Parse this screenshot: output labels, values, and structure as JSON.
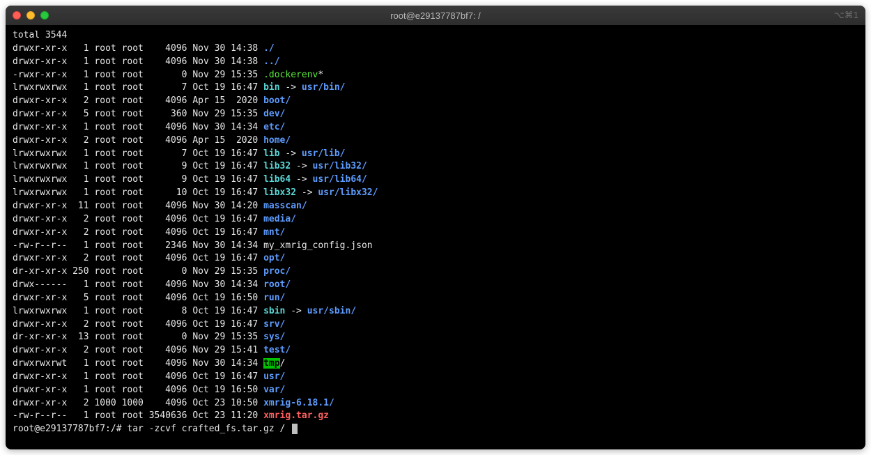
{
  "window": {
    "title": "root@e29137787bf7: /",
    "shell_indicator": "⌥⌘1"
  },
  "total_line": "total 3544",
  "rows": [
    {
      "perm": "drwxr-xr-x",
      "links": "1",
      "owner": "root",
      "group": "root",
      "size": "4096",
      "date": "Nov 30 14:38",
      "name": "./",
      "color": "blue"
    },
    {
      "perm": "drwxr-xr-x",
      "links": "1",
      "owner": "root",
      "group": "root",
      "size": "4096",
      "date": "Nov 30 14:38",
      "name": "../",
      "color": "blue"
    },
    {
      "perm": "-rwxr-xr-x",
      "links": "1",
      "owner": "root",
      "group": "root",
      "size": "0",
      "date": "Nov 29 15:35",
      "name": ".dockerenv",
      "suffix": "*",
      "color": "green"
    },
    {
      "perm": "lrwxrwxrwx",
      "links": "1",
      "owner": "root",
      "group": "root",
      "size": "7",
      "date": "Oct 19 16:47",
      "name": "bin",
      "color": "cyan",
      "arrow": " -> ",
      "target": "usr/bin/",
      "target_color": "blue"
    },
    {
      "perm": "drwxr-xr-x",
      "links": "2",
      "owner": "root",
      "group": "root",
      "size": "4096",
      "date": "Apr 15  2020",
      "name": "boot/",
      "color": "blue"
    },
    {
      "perm": "drwxr-xr-x",
      "links": "5",
      "owner": "root",
      "group": "root",
      "size": "360",
      "date": "Nov 29 15:35",
      "name": "dev/",
      "color": "blue"
    },
    {
      "perm": "drwxr-xr-x",
      "links": "1",
      "owner": "root",
      "group": "root",
      "size": "4096",
      "date": "Nov 30 14:34",
      "name": "etc/",
      "color": "blue"
    },
    {
      "perm": "drwxr-xr-x",
      "links": "2",
      "owner": "root",
      "group": "root",
      "size": "4096",
      "date": "Apr 15  2020",
      "name": "home/",
      "color": "blue"
    },
    {
      "perm": "lrwxrwxrwx",
      "links": "1",
      "owner": "root",
      "group": "root",
      "size": "7",
      "date": "Oct 19 16:47",
      "name": "lib",
      "color": "cyan",
      "arrow": " -> ",
      "target": "usr/lib/",
      "target_color": "blue"
    },
    {
      "perm": "lrwxrwxrwx",
      "links": "1",
      "owner": "root",
      "group": "root",
      "size": "9",
      "date": "Oct 19 16:47",
      "name": "lib32",
      "color": "cyan",
      "arrow": " -> ",
      "target": "usr/lib32/",
      "target_color": "blue"
    },
    {
      "perm": "lrwxrwxrwx",
      "links": "1",
      "owner": "root",
      "group": "root",
      "size": "9",
      "date": "Oct 19 16:47",
      "name": "lib64",
      "color": "cyan",
      "arrow": " -> ",
      "target": "usr/lib64/",
      "target_color": "blue"
    },
    {
      "perm": "lrwxrwxrwx",
      "links": "1",
      "owner": "root",
      "group": "root",
      "size": "10",
      "date": "Oct 19 16:47",
      "name": "libx32",
      "color": "cyan",
      "arrow": " -> ",
      "target": "usr/libx32/",
      "target_color": "blue"
    },
    {
      "perm": "drwxr-xr-x",
      "links": "11",
      "owner": "root",
      "group": "root",
      "size": "4096",
      "date": "Nov 30 14:20",
      "name": "masscan/",
      "color": "blue"
    },
    {
      "perm": "drwxr-xr-x",
      "links": "2",
      "owner": "root",
      "group": "root",
      "size": "4096",
      "date": "Oct 19 16:47",
      "name": "media/",
      "color": "blue"
    },
    {
      "perm": "drwxr-xr-x",
      "links": "2",
      "owner": "root",
      "group": "root",
      "size": "4096",
      "date": "Oct 19 16:47",
      "name": "mnt/",
      "color": "blue"
    },
    {
      "perm": "-rw-r--r--",
      "links": "1",
      "owner": "root",
      "group": "root",
      "size": "2346",
      "date": "Nov 30 14:34",
      "name": "my_xmrig_config.json",
      "color": "default"
    },
    {
      "perm": "drwxr-xr-x",
      "links": "2",
      "owner": "root",
      "group": "root",
      "size": "4096",
      "date": "Oct 19 16:47",
      "name": "opt/",
      "color": "blue"
    },
    {
      "perm": "dr-xr-xr-x",
      "links": "250",
      "owner": "root",
      "group": "root",
      "size": "0",
      "date": "Nov 29 15:35",
      "name": "proc/",
      "color": "blue"
    },
    {
      "perm": "drwx------",
      "links": "1",
      "owner": "root",
      "group": "root",
      "size": "4096",
      "date": "Nov 30 14:34",
      "name": "root/",
      "color": "blue"
    },
    {
      "perm": "drwxr-xr-x",
      "links": "5",
      "owner": "root",
      "group": "root",
      "size": "4096",
      "date": "Oct 19 16:50",
      "name": "run/",
      "color": "blue"
    },
    {
      "perm": "lrwxrwxrwx",
      "links": "1",
      "owner": "root",
      "group": "root",
      "size": "8",
      "date": "Oct 19 16:47",
      "name": "sbin",
      "color": "cyan",
      "arrow": " -> ",
      "target": "usr/sbin/",
      "target_color": "blue"
    },
    {
      "perm": "drwxr-xr-x",
      "links": "2",
      "owner": "root",
      "group": "root",
      "size": "4096",
      "date": "Oct 19 16:47",
      "name": "srv/",
      "color": "blue"
    },
    {
      "perm": "dr-xr-xr-x",
      "links": "13",
      "owner": "root",
      "group": "root",
      "size": "0",
      "date": "Nov 29 15:35",
      "name": "sys/",
      "color": "blue"
    },
    {
      "perm": "drwxr-xr-x",
      "links": "2",
      "owner": "root",
      "group": "root",
      "size": "4096",
      "date": "Nov 29 15:41",
      "name": "test/",
      "color": "blue"
    },
    {
      "perm": "drwxrwxrwt",
      "links": "1",
      "owner": "root",
      "group": "root",
      "size": "4096",
      "date": "Nov 30 14:34",
      "name": "tmp",
      "suffix": "/",
      "color": "tmp"
    },
    {
      "perm": "drwxr-xr-x",
      "links": "1",
      "owner": "root",
      "group": "root",
      "size": "4096",
      "date": "Oct 19 16:47",
      "name": "usr/",
      "color": "blue"
    },
    {
      "perm": "drwxr-xr-x",
      "links": "1",
      "owner": "root",
      "group": "root",
      "size": "4096",
      "date": "Oct 19 16:50",
      "name": "var/",
      "color": "blue"
    },
    {
      "perm": "drwxr-xr-x",
      "links": "2",
      "owner": "1000",
      "group": "1000",
      "size": "4096",
      "date": "Oct 23 10:50",
      "name": "xmrig-6.18.1/",
      "color": "blue"
    },
    {
      "perm": "-rw-r--r--",
      "links": "1",
      "owner": "root",
      "group": "root",
      "size": "3540636",
      "date": "Oct 23 11:20",
      "name": "xmrig.tar.gz",
      "color": "red"
    }
  ],
  "prompt": {
    "text": "root@e29137787bf7:/#",
    "command": "tar -zcvf crafted_fs.tar.gz /"
  }
}
